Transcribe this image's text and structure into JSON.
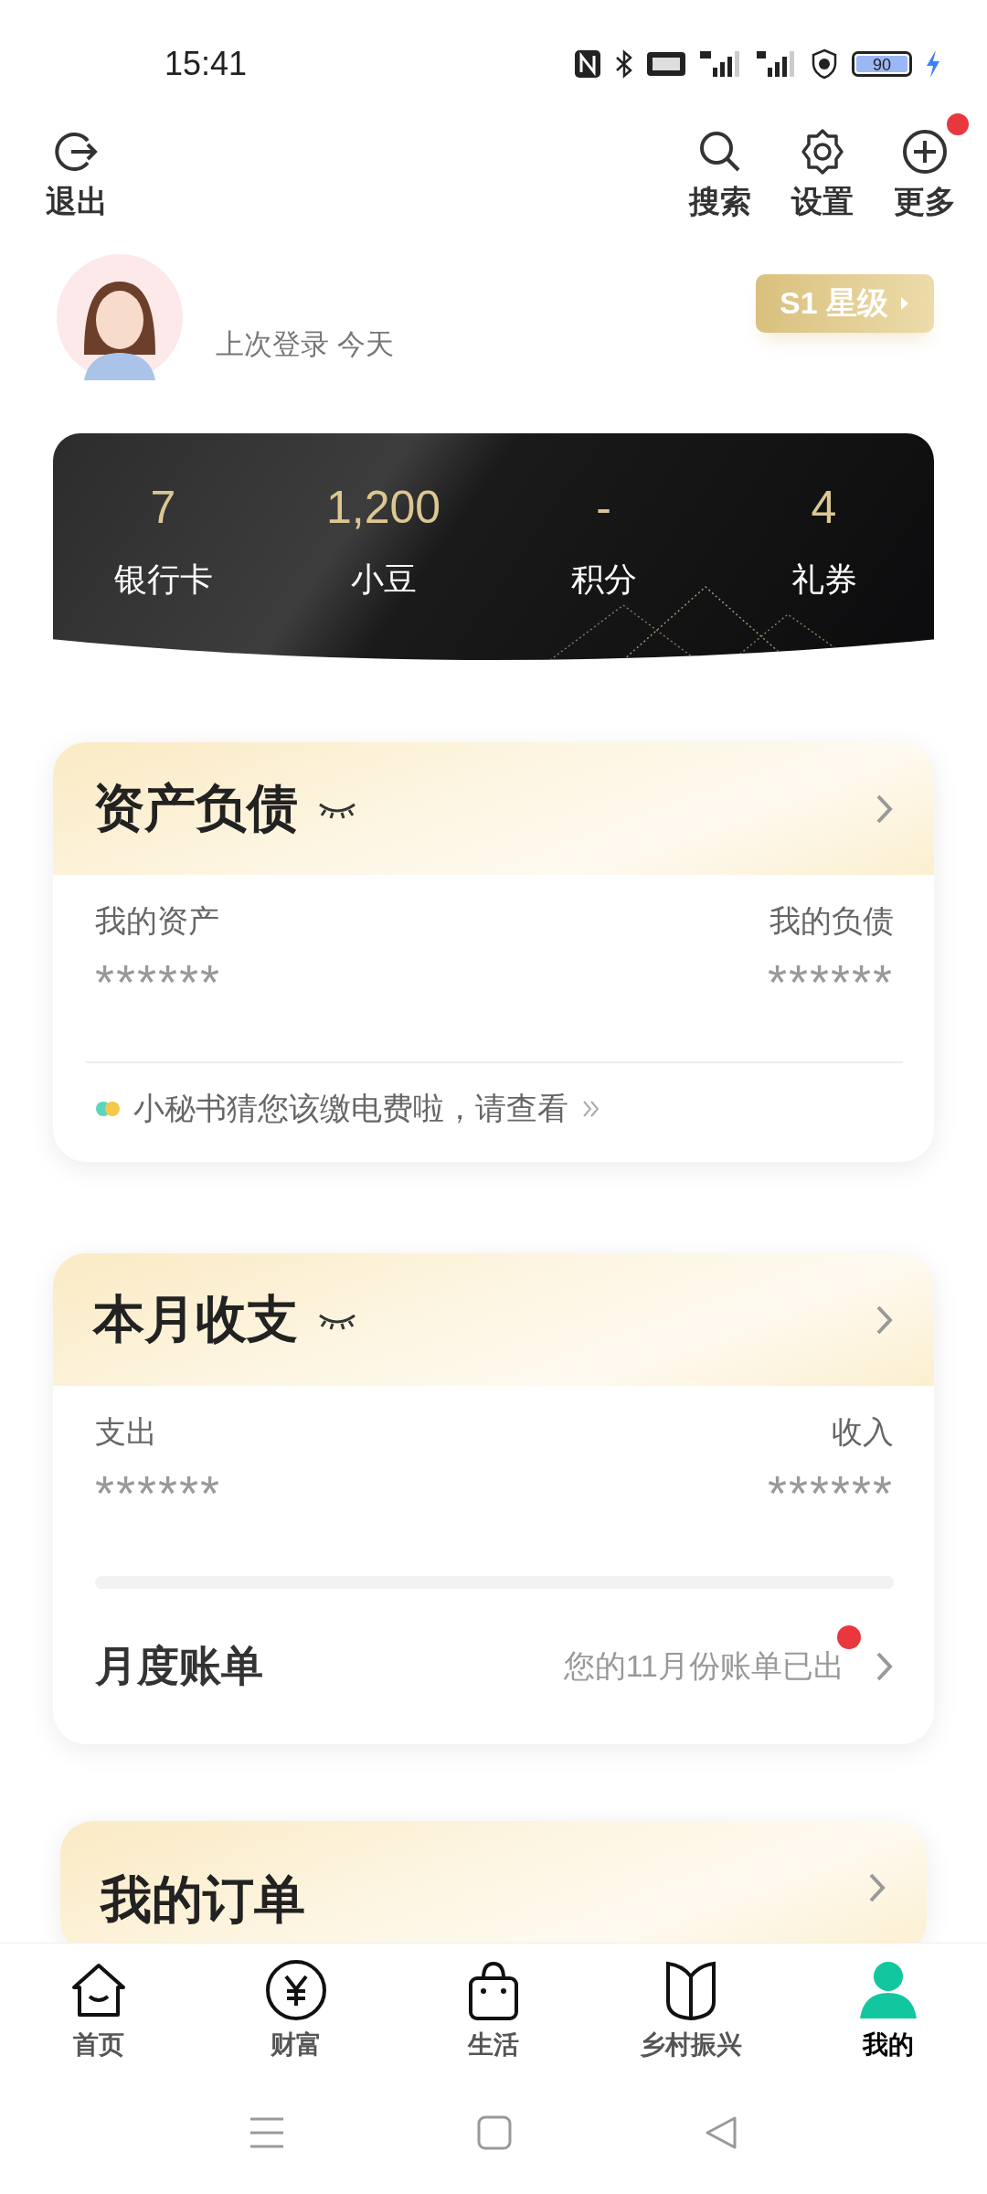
{
  "status_bar": {
    "time": "15:41",
    "battery": "90"
  },
  "top_actions": [
    {
      "label": "退出",
      "kind": "logout",
      "badge": false
    },
    {
      "label": "搜索",
      "kind": "search",
      "badge": false
    },
    {
      "label": "设置",
      "kind": "settings",
      "badge": false
    },
    {
      "label": "更多",
      "kind": "more",
      "badge": true
    }
  ],
  "profile": {
    "last_login": "上次登录 今天",
    "level_badge": "S1 星级"
  },
  "stats": [
    {
      "value": "7",
      "label": "银行卡"
    },
    {
      "value": "1,200",
      "label": "小豆"
    },
    {
      "value": "-",
      "label": "积分"
    },
    {
      "value": "4",
      "label": "礼券"
    }
  ],
  "asset_card": {
    "title": "资产负债",
    "left_label": "我的资产",
    "left_value": "******",
    "right_label": "我的负债",
    "right_value": "******",
    "tip": "小秘书猜您该缴电费啦，请查看"
  },
  "income_card": {
    "title": "本月收支",
    "left_label": "支出",
    "left_value": "******",
    "right_label": "收入",
    "right_value": "******",
    "bill_title": "月度账单",
    "bill_note": "您的11月份账单已出",
    "bill_unread": true
  },
  "orders_card": {
    "title": "我的订单"
  },
  "bottom_nav": [
    {
      "label": "首页",
      "kind": "home",
      "selected": false
    },
    {
      "label": "财富",
      "kind": "wealth",
      "selected": false
    },
    {
      "label": "生活",
      "kind": "life",
      "selected": false
    },
    {
      "label": "乡村振兴",
      "kind": "rural",
      "selected": false
    },
    {
      "label": "我的",
      "kind": "me",
      "selected": true
    }
  ]
}
